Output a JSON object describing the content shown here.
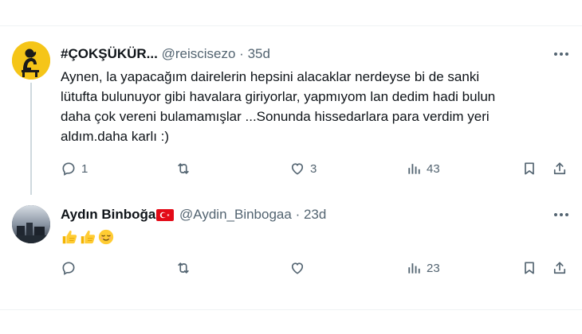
{
  "tweets": [
    {
      "display_name": "#ÇOKŞÜKÜR...",
      "handle": "@reiscisezo",
      "separator": "·",
      "time": "35d",
      "text": "Aynen, la yapacağım dairelerin hepsini alacaklar nerdeyse bi de sanki\nlütufta bulunuyor gibi havalara giriyorlar, yapmıyom lan dedim hadi bulun\ndaha çok vereni bulamamışlar ...Sonunda hissedarlara para verdim yeri\naldım.daha karlı :)",
      "actions": {
        "replies": "1",
        "reposts": "",
        "likes": "3",
        "views": "43"
      }
    },
    {
      "display_name": "Aydın Binboğa",
      "handle": "@Aydin_Binbogaa",
      "separator": "·",
      "time": "23d",
      "emojis": [
        "thumbs-up",
        "thumbs-up",
        "relieved-face"
      ],
      "actions": {
        "replies": "",
        "reposts": "",
        "likes": "",
        "views": "23"
      }
    }
  ],
  "icons": {
    "reply": "reply-icon",
    "repost": "repost-icon",
    "like": "heart-icon",
    "views": "views-icon",
    "bookmark": "bookmark-icon",
    "share": "share-icon",
    "more": "more-icon"
  },
  "colors": {
    "text_primary": "#0f1419",
    "text_secondary": "#536471",
    "divider": "#eff3f4",
    "thread_line": "#cfd9de",
    "avatar1_bg": "#f5c518",
    "flag_red": "#e30a17"
  }
}
